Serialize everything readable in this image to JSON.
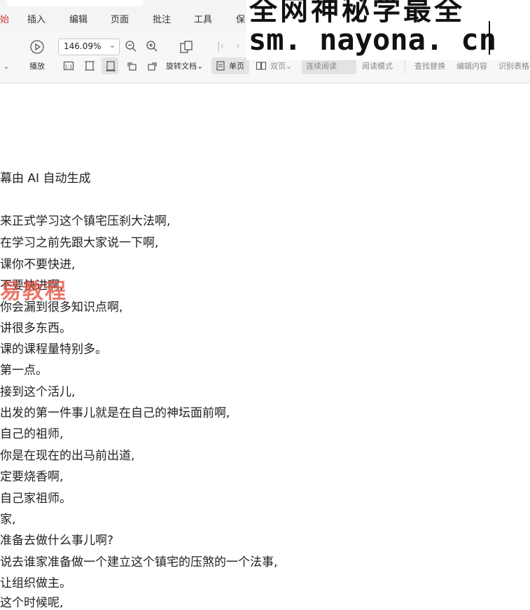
{
  "tabs": [
    {
      "label": "始",
      "active": true
    },
    {
      "label": "插入"
    },
    {
      "label": "编辑"
    },
    {
      "label": "页面"
    },
    {
      "label": "批注"
    },
    {
      "label": "工具"
    },
    {
      "label": "保"
    }
  ],
  "toolbar": {
    "play_label": "播放",
    "zoom_value": "146.09%",
    "rotate_label": "旋转文档",
    "single_page_label": "单页",
    "double_page_label": "双页",
    "continuous_label": "连续阅读",
    "read_mode_label": "阅读模式",
    "find_replace_label": "查找替换",
    "edit_content_label": "编辑内容",
    "recognize_table_label": "识别表格"
  },
  "watermark": {
    "line1": "全网神秘学最全",
    "line2": "sm. nayona. cn"
  },
  "stamp_text": "易教程",
  "document": {
    "lines": [
      "幕由 AI 自动生成",
      "来正式学习这个镇宅压刹大法啊,",
      "在学习之前先跟大家说一下啊,",
      "课你不要快进,",
      "不要快进啊,",
      "你会漏到很多知识点啊,",
      "讲很多东西。",
      "课的课程量特别多。",
      "第一点。",
      "接到这个活儿,",
      "出发的第一件事儿就是在自己的神坛面前啊,",
      "自己的祖师,",
      "你是在现在的出马前出道,",
      "定要烧香啊,",
      "自己家祖师。",
      "家,",
      "准备去做什么事儿啊?",
      "说去谁家准备做一个建立这个镇宅的压煞的一个法事,",
      "让组织做主。",
      "这个时候呢,"
    ]
  }
}
